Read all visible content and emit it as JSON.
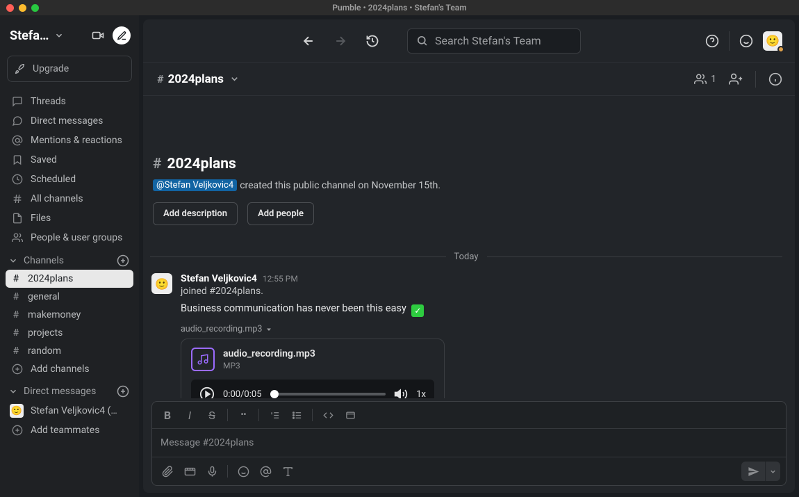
{
  "titlebar": "Pumble • 2024plans • Stefan's Team",
  "workspace": {
    "name": "Stefa…"
  },
  "upgrade_label": "Upgrade",
  "sidebar": {
    "nav": [
      {
        "icon": "threads",
        "label": "Threads"
      },
      {
        "icon": "dm",
        "label": "Direct messages"
      },
      {
        "icon": "mentions",
        "label": "Mentions & reactions"
      },
      {
        "icon": "saved",
        "label": "Saved"
      },
      {
        "icon": "scheduled",
        "label": "Scheduled"
      },
      {
        "icon": "allchannels",
        "label": "All channels"
      },
      {
        "icon": "files",
        "label": "Files"
      },
      {
        "icon": "people",
        "label": "People & user groups"
      }
    ],
    "channels_header": "Channels",
    "channels": [
      {
        "name": "2024plans",
        "active": true
      },
      {
        "name": "general"
      },
      {
        "name": "makemoney"
      },
      {
        "name": "projects"
      },
      {
        "name": "random"
      }
    ],
    "add_channels": "Add channels",
    "dm_header": "Direct messages",
    "dms": [
      {
        "name": "Stefan Veljkovic4 (…"
      }
    ],
    "add_teammates": "Add teammates"
  },
  "search": {
    "placeholder": "Search Stefan's Team"
  },
  "channel_header": {
    "name": "2024plans",
    "member_count": "1"
  },
  "intro": {
    "hash_name": "2024plans",
    "creator": "@Stefan Veljkovic4",
    "created_text": " created this public channel on November 15th.",
    "add_description": "Add description",
    "add_people": "Add people"
  },
  "divider_label": "Today",
  "message": {
    "author": "Stefan Veljkovic4",
    "time": "12:55 PM",
    "event": "joined #2024plans.",
    "text": "Business communication has never been this easy ",
    "attachment_line": "audio_recording.mp3",
    "audio": {
      "filename": "audio_recording.mp3",
      "type": "MP3",
      "time": "0:00/0:05",
      "speed": "1x"
    }
  },
  "composer": {
    "placeholder": "Message #2024plans"
  }
}
